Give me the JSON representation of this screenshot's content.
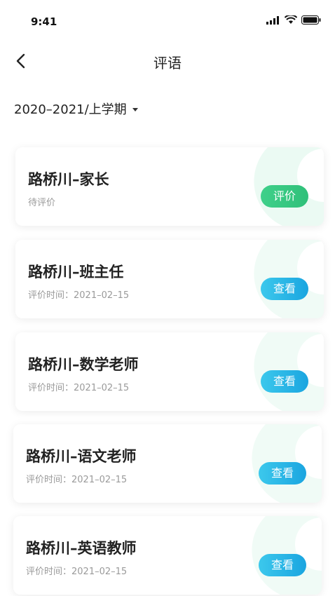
{
  "status_bar": {
    "time": "9:41"
  },
  "nav": {
    "title": "评语"
  },
  "term": {
    "label": "2020–2021/上学期"
  },
  "cards": [
    {
      "name": "路桥川–家长",
      "sub": "待评价",
      "button": "评价",
      "color": "#3fd08a"
    },
    {
      "name": "路桥川–班主任",
      "sub": "评价时间：2021–02–15",
      "button": "查看",
      "color": "#1aa5e0"
    },
    {
      "name": "路桥川–数学老师",
      "sub": "评价时间：2021–02–15",
      "button": "查看",
      "color": "#1aa5e0"
    },
    {
      "name": "路桥川–语文老师",
      "sub": "评价时间：2021–02–15",
      "button": "查看",
      "color": "#1aa5e0"
    },
    {
      "name": "路桥川–英语教师",
      "sub": "评价时间：2021–02–15",
      "button": "查看",
      "color": "#1aa5e0"
    }
  ]
}
